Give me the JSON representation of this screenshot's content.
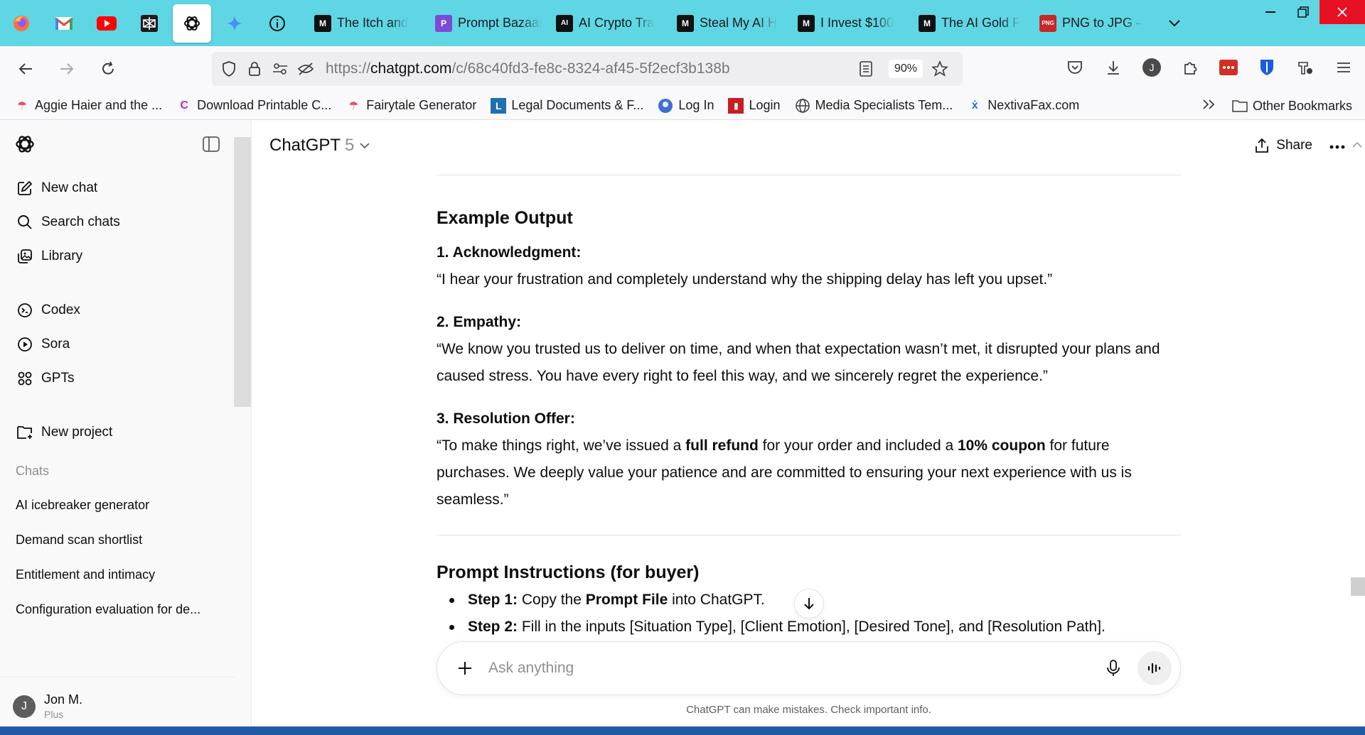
{
  "browser": {
    "pinned_tabs": [
      {
        "name": "firefox"
      },
      {
        "name": "gmail"
      },
      {
        "name": "youtube"
      },
      {
        "name": "perplexity"
      },
      {
        "name": "chatgpt"
      },
      {
        "name": "gemini"
      },
      {
        "name": "info"
      }
    ],
    "tabs": [
      {
        "title": "The Itch and",
        "fav": "M"
      },
      {
        "title": "Prompt Bazaar",
        "fav": "P"
      },
      {
        "title": "AI Crypto Tra",
        "fav": "AI"
      },
      {
        "title": "Steal My AI H",
        "fav": "M"
      },
      {
        "title": "I Invest $100",
        "fav": "M"
      },
      {
        "title": "The AI Gold F",
        "fav": "M"
      },
      {
        "title": "PNG to JPG –",
        "fav": "PNG"
      }
    ],
    "url_host": "chatgpt.com",
    "url_prefix": "https://",
    "url_path": "/c/68c40fd3-fe8c-8324-af45-5f2ecf3b138b",
    "zoom": "90%",
    "profile_initial": "J",
    "bookmarks": [
      {
        "label": "Aggie Haier and the ..."
      },
      {
        "label": "Download Printable C..."
      },
      {
        "label": "Fairytale Generator"
      },
      {
        "label": "Legal Documents & F..."
      },
      {
        "label": "Log In"
      },
      {
        "label": "Login"
      },
      {
        "label": "Media Specialists Tem..."
      },
      {
        "label": "NextivaFax.com"
      }
    ],
    "other_bookmarks": "Other Bookmarks"
  },
  "sidebar": {
    "nav": [
      {
        "label": "New chat",
        "icon": "edit-icon"
      },
      {
        "label": "Search chats",
        "icon": "search-icon"
      },
      {
        "label": "Library",
        "icon": "library-icon"
      }
    ],
    "apps": [
      {
        "label": "Codex",
        "icon": "codex-icon"
      },
      {
        "label": "Sora",
        "icon": "sora-icon"
      },
      {
        "label": "GPTs",
        "icon": "gpts-icon"
      }
    ],
    "new_project": "New project",
    "chats_heading": "Chats",
    "chats": [
      "AI icebreaker generator",
      "Demand scan shortlist",
      "Entitlement and intimacy",
      "Configuration evaluation for de..."
    ],
    "user": {
      "initial": "J",
      "name": "Jon M.",
      "plan": "Plus"
    }
  },
  "header": {
    "model": "ChatGPT",
    "version": "5",
    "share": "Share"
  },
  "message": {
    "example_heading": "Example Output",
    "ack_label": "1. Acknowledgment:",
    "ack_text": "“I hear your frustration and completely understand why the shipping delay has left you upset.”",
    "emp_label": "2. Empathy:",
    "emp_text": "“We know you trusted us to deliver on time, and when that expectation wasn’t met, it disrupted your plans and caused stress. You have every right to feel this way, and we sincerely regret the experience.”",
    "res_label": "3. Resolution Offer:",
    "res_text_1": "“To make things right, we’ve issued a ",
    "res_bold_1": "full refund",
    "res_text_2": " for your order and included a ",
    "res_bold_2": "10% coupon",
    "res_text_3": " for future purchases. We deeply value your patience and are committed to ensuring your next experience with us is seamless.”",
    "instructions_heading": "Prompt Instructions (for buyer)",
    "step1_label": "Step 1:",
    "step1_text_1": " Copy the ",
    "step1_bold": "Prompt File",
    "step1_text_2": " into ChatGPT.",
    "step2_label": "Step 2:",
    "step2_text": " Fill in the inputs [Situation Type], [Client Emotion], [Desired Tone], and [Resolution Path]."
  },
  "composer": {
    "placeholder": "Ask anything",
    "disclaimer": "ChatGPT can make mistakes. Check important info."
  }
}
